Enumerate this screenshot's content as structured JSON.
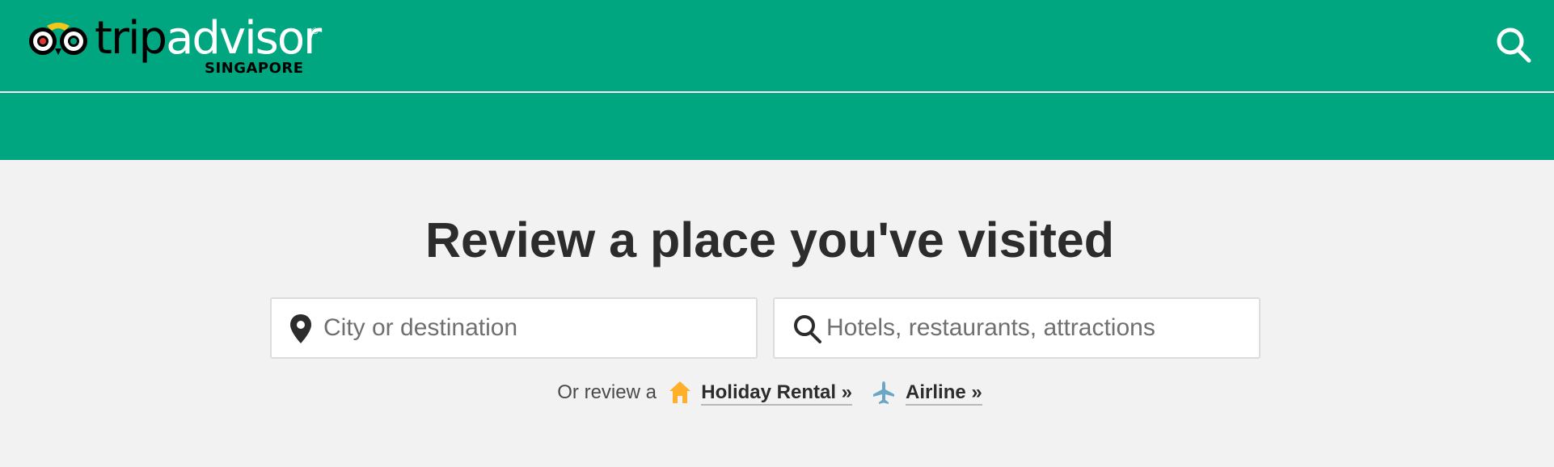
{
  "header": {
    "logo_trip": "trip",
    "logo_advisor": "advisor",
    "logo_registered": "®",
    "logo_region": "SINGAPORE",
    "search_icon": "search-icon",
    "bar_color": "#00a680"
  },
  "main": {
    "title": "Review a place you've visited",
    "destination_field": {
      "placeholder": "City or destination",
      "value": "",
      "icon": "map-pin-icon"
    },
    "place_field": {
      "placeholder": "Hotels, restaurants, attractions",
      "value": "",
      "icon": "search-icon"
    },
    "or_review": {
      "lead_text": "Or review a",
      "options": [
        {
          "label": "Holiday Rental »",
          "icon": "house-icon",
          "icon_color": "#ffaf2a"
        },
        {
          "label": "Airline »",
          "icon": "airplane-icon",
          "icon_color": "#6aa7c6"
        }
      ]
    }
  }
}
